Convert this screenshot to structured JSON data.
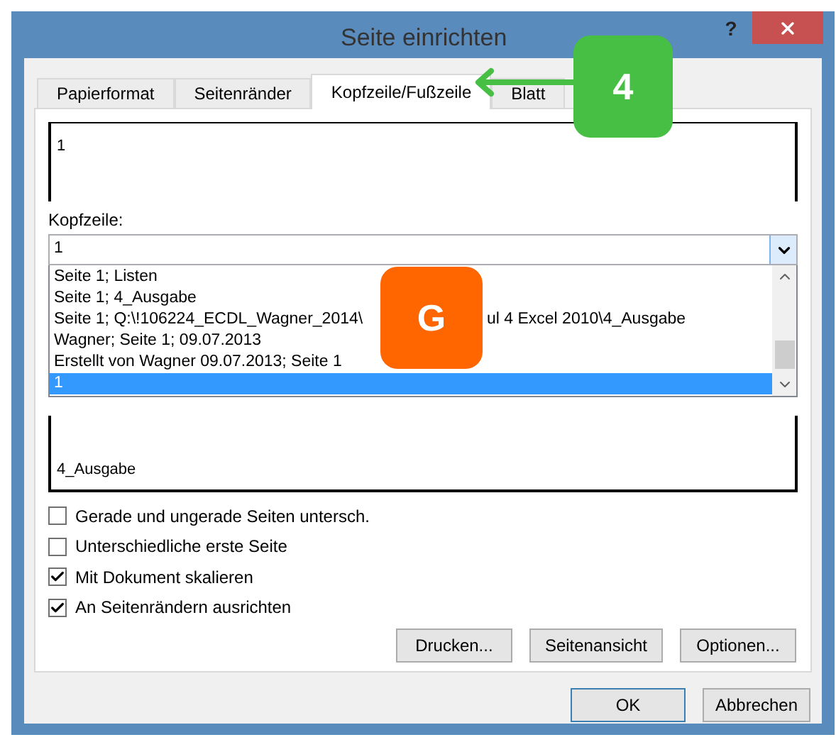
{
  "window": {
    "title": "Seite einrichten",
    "help": "?"
  },
  "tabs": [
    {
      "label": "Papierformat",
      "selected": false
    },
    {
      "label": "Seitenränder",
      "selected": false
    },
    {
      "label": "Kopfzeile/Fußzeile",
      "selected": true
    },
    {
      "label": "Blatt",
      "selected": false
    }
  ],
  "header_preview": {
    "text": "1"
  },
  "header_select": {
    "label": "Kopfzeile:",
    "value": "1",
    "options": [
      {
        "text": "Seite 1; Listen",
        "selected": false
      },
      {
        "text": "Seite 1; 4_Ausgabe",
        "selected": false
      },
      {
        "text": "Seite 1; Q:\\!106224_ECDL_Wagner_2014\\",
        "text_after_callout": "ul 4 Excel 2010\\4_Ausgabe",
        "selected": false
      },
      {
        "text": "Wagner; Seite 1; 09.07.2013",
        "selected": false
      },
      {
        "text": "Erstellt von Wagner 09.07.2013; Seite 1",
        "selected": false
      },
      {
        "text": "1",
        "selected": true
      }
    ]
  },
  "footer_preview": {
    "text": "4_Ausgabe"
  },
  "checkboxes": [
    {
      "label": "Gerade und ungerade Seiten untersch.",
      "checked": false
    },
    {
      "label": "Unterschiedliche erste Seite",
      "checked": false
    },
    {
      "label": "Mit Dokument skalieren",
      "checked": true
    },
    {
      "label": "An Seitenrändern ausrichten",
      "checked": true
    }
  ],
  "buttons": [
    "Drucken...",
    "Seitenansicht",
    "Optionen..."
  ],
  "dialog_buttons": [
    {
      "label": "OK",
      "default": true
    },
    {
      "label": "Abbrechen",
      "default": false
    }
  ],
  "callouts": [
    {
      "kind": "arrow",
      "text": "4",
      "color": "#47bf45"
    },
    {
      "kind": "plain",
      "text": "G",
      "color": "#ff6600"
    }
  ]
}
